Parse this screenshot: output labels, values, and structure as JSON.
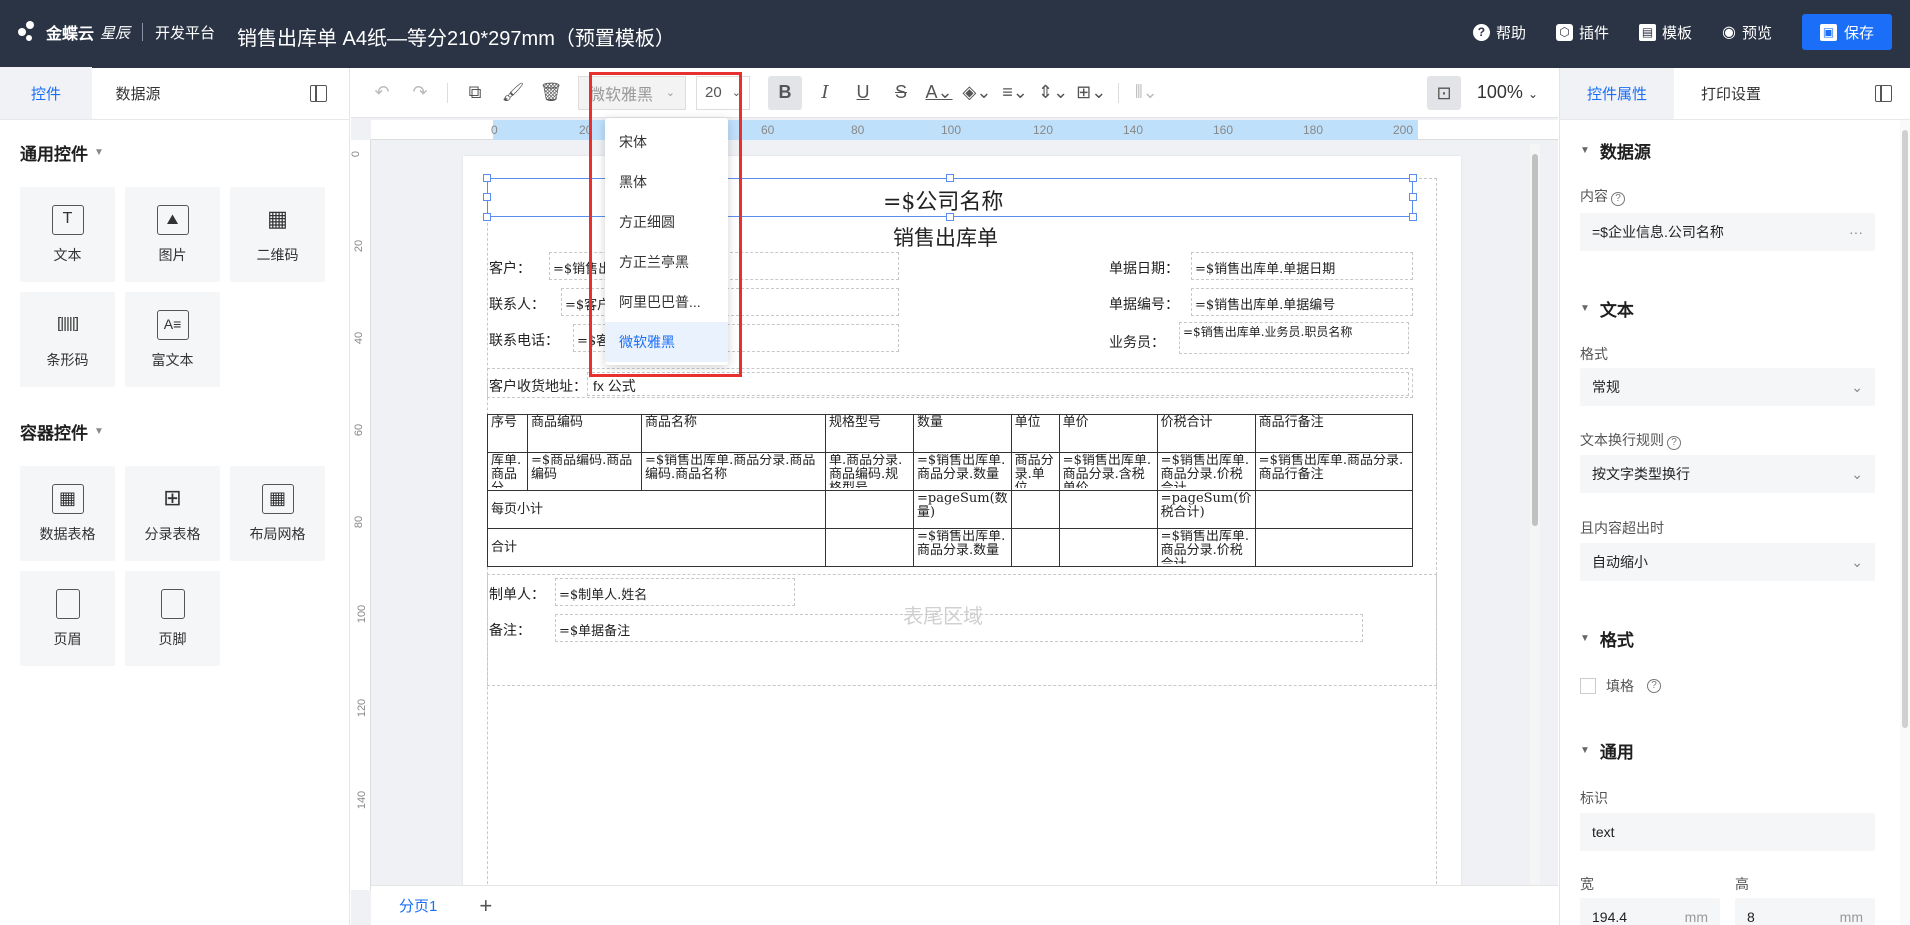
{
  "topbar": {
    "brand": "金蝶云",
    "brand_sub": "星辰",
    "platform": "开发平台",
    "doc_title": "销售出库单 A4纸—等分210*297mm（预置模板）",
    "actions": {
      "help": "帮助",
      "plugin": "插件",
      "template": "模板",
      "preview": "预览",
      "save": "保存"
    }
  },
  "left": {
    "tabs": [
      "控件",
      "数据源"
    ],
    "common_title": "通用控件",
    "common_items": [
      "文本",
      "图片",
      "二维码",
      "条形码",
      "富文本"
    ],
    "container_title": "容器控件",
    "container_items": [
      "数据表格",
      "分录表格",
      "布局网格",
      "页眉",
      "页脚"
    ]
  },
  "toolbar": {
    "font": "微软雅黑",
    "size": "20",
    "zoom": "100%"
  },
  "font_dropdown": {
    "options": [
      "宋体",
      "黑体",
      "方正细圆",
      "方正兰亭黑",
      "阿里巴巴普...",
      "微软雅黑"
    ],
    "selected": "微软雅黑"
  },
  "ruler": {
    "top": [
      "0",
      "20",
      "40",
      "60",
      "80",
      "100",
      "120",
      "140",
      "160",
      "180",
      "200"
    ],
    "left": [
      "0",
      "20",
      "40",
      "60",
      "80",
      "100",
      "120",
      "140"
    ]
  },
  "page": {
    "company": "=$公司名称",
    "title": "销售出库单",
    "customer_label": "客户：",
    "customer_value": "=$销售出库单.客户名称",
    "contact_label": "联系人：",
    "contact_value": "=$客户.联系人",
    "phone_label": "联系电话：",
    "phone_value": "=$客户.联系电话",
    "date_label": "单据日期：",
    "date_value": "=$销售出库单.单据日期",
    "no_label": "单据编号：",
    "no_value": "=$销售出库单.单据编号",
    "sales_label": "业务员：",
    "sales_value": "=$销售出库单.业务员.职员名称",
    "addr_label": "客户收货地址：",
    "addr_value": "fx 公式",
    "table_headers": [
      "序号",
      "商品编码",
      "商品名称",
      "规格型号",
      "数量",
      "单位",
      "单价",
      "价税合计",
      "商品行备注"
    ],
    "table_row": [
      "库单.商品分",
      "=$商品编码.商品编码",
      "=$销售出库单.商品分录.商品编码.商品名称",
      "单.商品分录.商品编码.规格型号",
      "=$销售出库单.商品分录.数量",
      "商品分录.单位",
      "=$销售出库单.商品分录.含税单价",
      "=$销售出库单.商品分录.价税合计",
      "=$销售出库单.商品分录.商品行备注"
    ],
    "page_subtotal": "每页小计",
    "subtotal_qty": "=pageSum(数量)",
    "subtotal_amount": "=pageSum(价税合计)",
    "total": "合计",
    "total_qty": "=$销售出库单.商品分录.数量",
    "total_amount": "=$销售出库单.商品分录.价税合计",
    "maker_label": "制单人：",
    "maker_value": "=$制单人.姓名",
    "remark_label": "备注：",
    "remark_value": "=$单据备注",
    "footer_area": "表尾区域"
  },
  "bottom": {
    "page_tab": "分页1"
  },
  "right": {
    "tabs": [
      "控件属性",
      "打印设置"
    ],
    "datasource_title": "数据源",
    "content_label": "内容",
    "content_value": "=$企业信息.公司名称",
    "text_title": "文本",
    "format_label": "格式",
    "format_value": "常规",
    "wrap_label": "文本换行规则",
    "wrap_value": "按文字类型换行",
    "overflow_label": "且内容超出时",
    "overflow_value": "自动缩小",
    "format2_title": "格式",
    "fill_label": "填格",
    "general_title": "通用",
    "id_label": "标识",
    "id_value": "text",
    "width_label": "宽",
    "width_value": "194.4",
    "height_label": "高",
    "height_value": "8",
    "unit": "mm"
  },
  "colors": {
    "accent": "#1a6ef7",
    "topbar": "#2b3445",
    "highlight": "#e8312f"
  }
}
